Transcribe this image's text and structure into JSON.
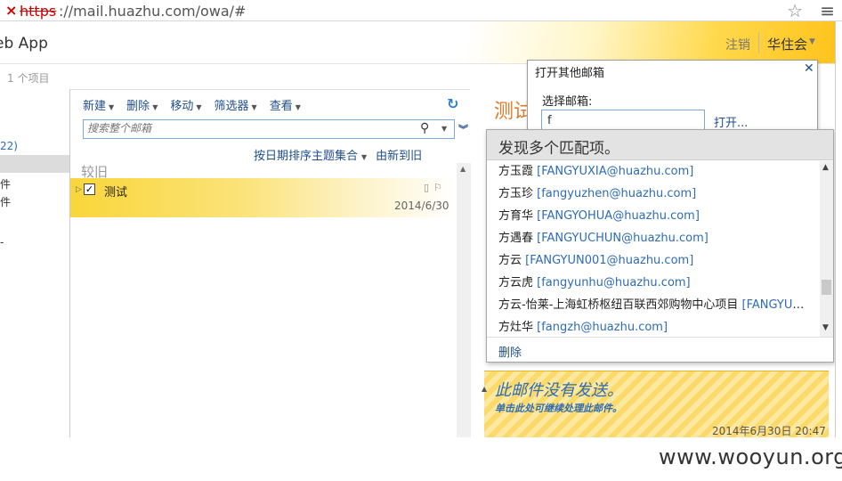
{
  "browser": {
    "url_scheme": "https",
    "url_rest": "://mail.huazhu.com/owa/#"
  },
  "header": {
    "app_title": "eb App",
    "logout": "注销",
    "user": "华住会"
  },
  "list": {
    "item_count": "1 个项目",
    "toolbar": {
      "new": "新建",
      "delete": "删除",
      "move": "移动",
      "filter": "筛选器",
      "view": "查看"
    },
    "search_placeholder": "搜索整个邮箱",
    "sort_by": "按日期排序主题集合",
    "sort_order": "由新到旧",
    "group_label": "较旧",
    "message": {
      "subject": "测试",
      "date": "2014/6/30"
    }
  },
  "folders": {
    "unread_count": "22)",
    "item1": "件",
    "item2": "件",
    "item3": "-"
  },
  "reading": {
    "subject": "测试",
    "not_sent_title": "此邮件没有发送。",
    "not_sent_sub": "单击此处可继续处理此邮件。",
    "date": "2014年6月30日 20:47"
  },
  "dialog": {
    "title": "打开其他邮箱",
    "select_label": "选择邮箱:",
    "input_value": "f",
    "open_link": "打开..."
  },
  "matches": {
    "header": "发现多个匹配项。",
    "items": [
      {
        "name": "方玉霞",
        "email": "[FANGYUXIA@huazhu.com]"
      },
      {
        "name": "方玉珍",
        "email": "[fangyuzhen@huazhu.com]"
      },
      {
        "name": "方育华",
        "email": "[FANGYOHUA@huazhu.com]"
      },
      {
        "name": "方遇春",
        "email": "[FANGYUCHUN@huazhu.com]"
      },
      {
        "name": "方云",
        "email": "[FANGYUN001@huazhu.com]"
      },
      {
        "name": "方云虎",
        "email": "[fangyunhu@huazhu.com]"
      },
      {
        "name": "方云-怡莱-上海虹桥枢纽百联西郊购物中心项目",
        "email": "[FANGYUN..."
      },
      {
        "name": "方灶华",
        "email": "[fangzh@huazhu.com]"
      }
    ],
    "delete": "删除"
  },
  "watermark": "www.wooyun.org"
}
